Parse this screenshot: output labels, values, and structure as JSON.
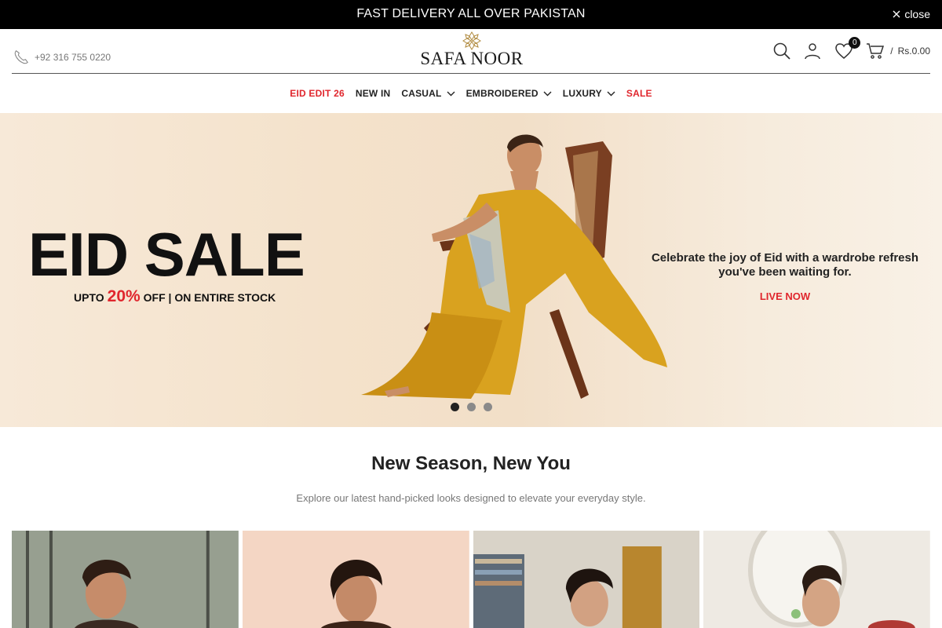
{
  "announcement": {
    "text": "FAST DELIVERY ALL OVER PAKISTAN",
    "close_label": "close"
  },
  "header": {
    "phone": "+92 316 755 0220",
    "logo_text": "SAFA NOOR",
    "wishlist_count": "0",
    "cart_separator": "/",
    "cart_total": "Rs.0.00",
    "icons": [
      "phone-icon",
      "search-icon",
      "account-icon",
      "heart-icon",
      "cart-icon"
    ]
  },
  "nav": {
    "items": [
      {
        "label": "EID EDIT 26",
        "highlight": true,
        "dropdown": false
      },
      {
        "label": "NEW IN",
        "highlight": false,
        "dropdown": false
      },
      {
        "label": "CASUAL",
        "highlight": false,
        "dropdown": true
      },
      {
        "label": "EMBROIDERED",
        "highlight": false,
        "dropdown": true
      },
      {
        "label": "LUXURY",
        "highlight": false,
        "dropdown": true
      },
      {
        "label": "SALE",
        "highlight": true,
        "dropdown": false
      }
    ]
  },
  "hero": {
    "title": "EID SALE",
    "sub_prefix": "UPTO",
    "sub_percent": "20%",
    "sub_suffix": "OFF | ON ENTIRE STOCK",
    "tagline_line1": "Celebrate the joy of Eid with a wardrobe refresh",
    "tagline_line2": "you've been waiting for.",
    "cta": "LIVE NOW",
    "slides": 3,
    "active_slide": 1
  },
  "section": {
    "title": "New Season, New You",
    "subtitle": "Explore our latest hand-picked looks designed to elevate your everyday style."
  },
  "colors": {
    "accent_red": "#e0262d",
    "announcement_bg": "#000000",
    "hero_bg": "#f4e2cb",
    "dress_mustard": "#d9a21f"
  }
}
